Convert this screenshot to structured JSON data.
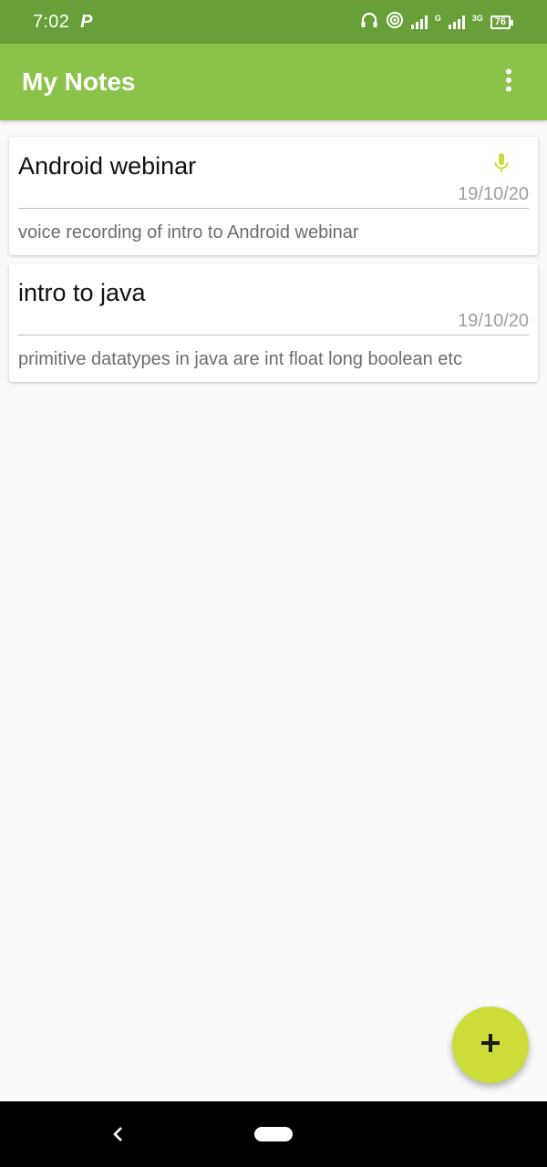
{
  "status_bar": {
    "time": "7:02",
    "app_indicator": "P",
    "network_1": "G",
    "network_2": "3G",
    "battery": "76"
  },
  "app_bar": {
    "title": "My Notes",
    "menu_icon": "more-vert-icon"
  },
  "notes": [
    {
      "title": "Android webinar",
      "date": "19/10/20",
      "body": "voice recording of intro to Android webinar",
      "has_audio": true
    },
    {
      "title": "intro to java",
      "date": "19/10/20",
      "body": "primitive datatypes in java are int float long boolean etc",
      "has_audio": false
    }
  ],
  "fab": {
    "icon": "add-icon"
  },
  "nav_bar": {
    "back_icon": "back-icon",
    "home_icon": "home-pill-icon"
  },
  "colors": {
    "status_bar": "#689f38",
    "app_bar": "#8bc34a",
    "fab": "#cddc39",
    "mic_icon": "#cddc39"
  }
}
